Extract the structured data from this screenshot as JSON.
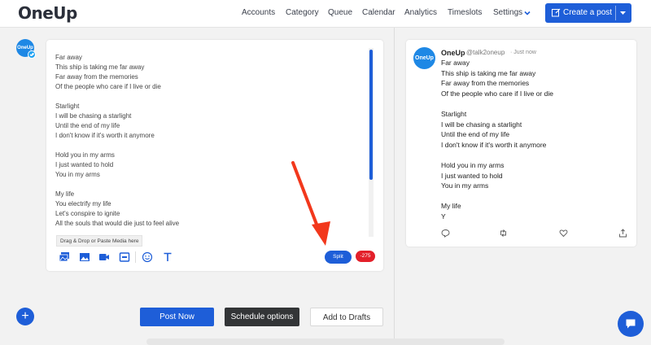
{
  "header": {
    "logo": "OneUp",
    "nav": [
      "Accounts",
      "Category",
      "Queue",
      "Calendar",
      "Analytics",
      "Timeslots",
      "Settings"
    ],
    "create_post": "Create a post"
  },
  "composer": {
    "avatar_text": "OneUp",
    "text": "Far away\nThis ship is taking me far away\nFar away from the memories\nOf the people who care if I live or die\n\nStarlight\nI will be chasing a starlight\nUntil the end of my life\nI don't know if it's worth it anymore\n\nHold you in my arms\nI just wanted to hold\nYou in my arms\n\nMy life\nYou electrify my life\nLet's conspire to ignite\nAll the souls that would die just to feel alive",
    "drop_hint": "Drag & Drop or Paste Media here",
    "split_label": "Split",
    "char_count": "-275",
    "tools": [
      "gallery-icon",
      "image-icon",
      "video-icon",
      "gif-icon",
      "emoji-icon",
      "text-format-icon"
    ]
  },
  "actions": {
    "post_now": "Post Now",
    "schedule": "Schedule options",
    "drafts": "Add to Drafts"
  },
  "preview": {
    "avatar_text": "OneUp",
    "name": "OneUp",
    "handle": "@talk2oneup",
    "time": "· Just now",
    "text": "Far away\nThis ship is taking me far away\nFar away from the memories\nOf the people who care if I live or die\n\nStarlight\nI will be chasing a starlight\nUntil the end of my life\nI don't know if it's worth it anymore\n\nHold you in my arms\nI just wanted to hold\nYou in my arms\n\nMy life\nY"
  },
  "colors": {
    "primary": "#1e5ed8",
    "dark_button": "#333537",
    "danger": "#e3202a",
    "arrow": "#f2381c"
  }
}
